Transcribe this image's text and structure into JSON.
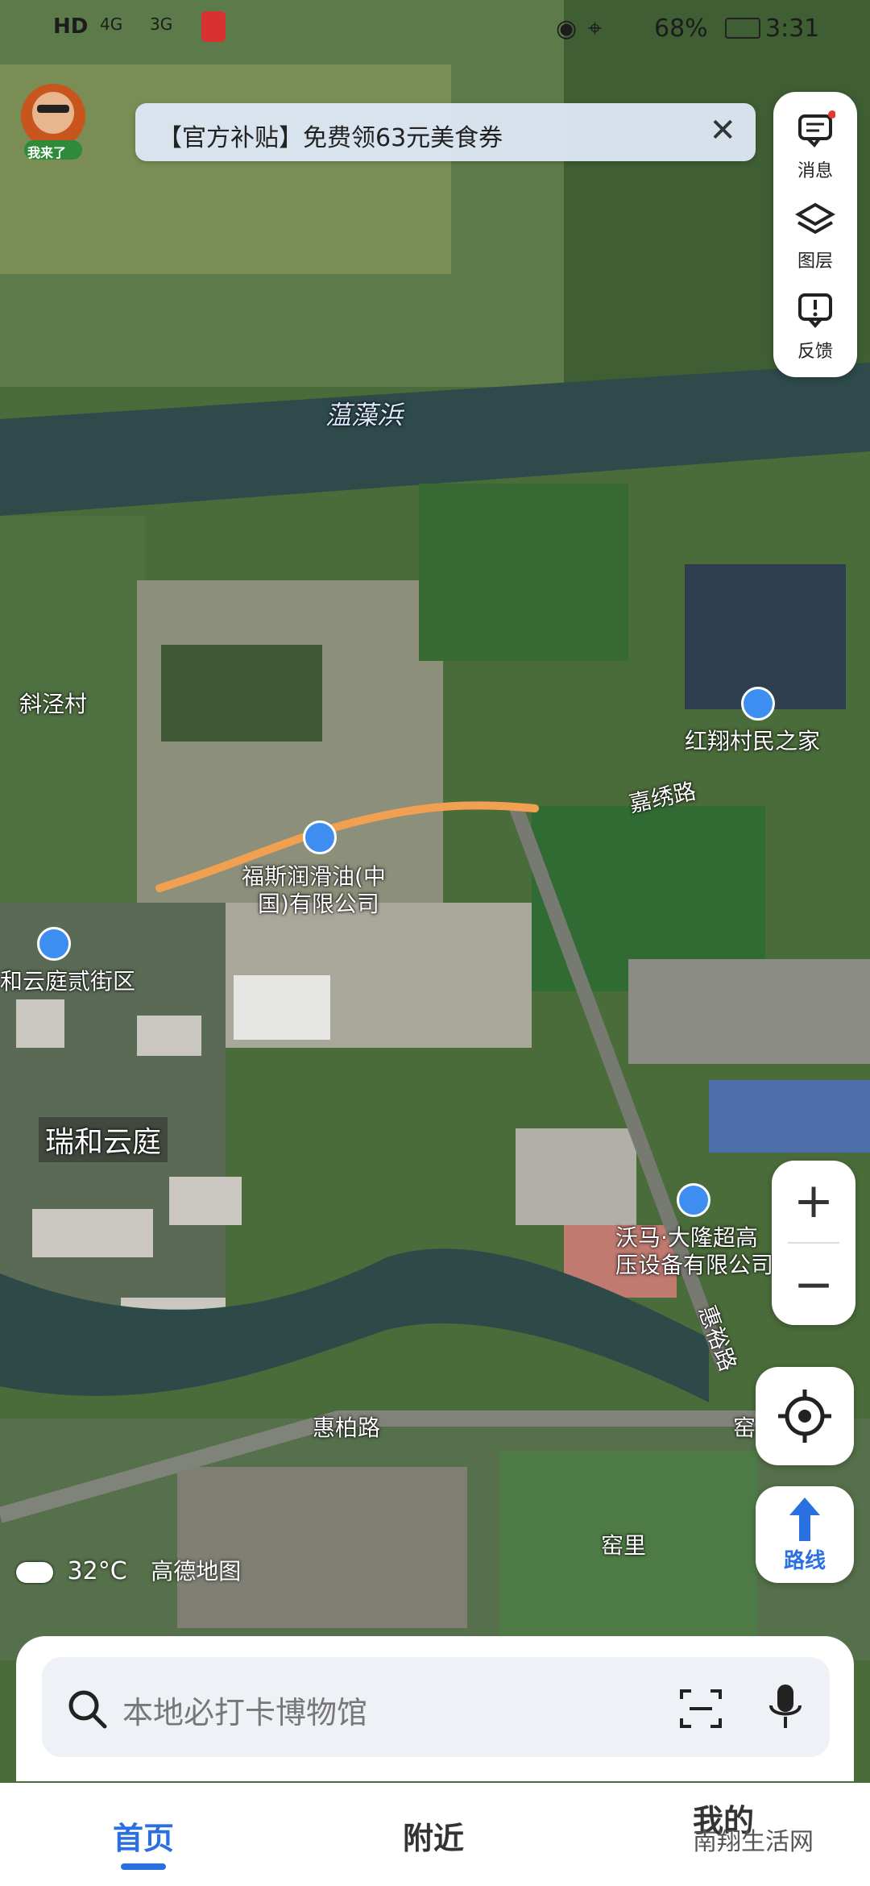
{
  "status_bar": {
    "network_left": "HD",
    "signal_1": "4G",
    "signal_2": "3G",
    "battery": "68%",
    "time": "3:31"
  },
  "banner": {
    "text": "【官方补贴】免费领63元美食券",
    "close_icon": "close-icon"
  },
  "avatar": {
    "badge": "我来了"
  },
  "right_panel": {
    "items": [
      {
        "label": "消息",
        "icon": "message-icon"
      },
      {
        "label": "图层",
        "icon": "layers-icon"
      },
      {
        "label": "反馈",
        "icon": "feedback-icon"
      }
    ]
  },
  "map_labels": {
    "river": "蕰藻浜",
    "village_west": "斜泾村",
    "community_center": "红翔村民之家",
    "road_jiaxiu": "嘉绣路",
    "company_line1": "福斯润滑油(中",
    "company_line2": "国)有限公司",
    "residential_area": "和云庭贰街区",
    "ruihe": "瑞和云庭",
    "walmart_line1": "沃马·大隆超高",
    "walmart_line2": "压设备有限公司",
    "road_huiyu": "惠裕路",
    "road_huibai": "惠柏路",
    "yaoli_edge": "窑",
    "yaoli": "窑里"
  },
  "weather": {
    "temp": "32°C",
    "brand": "高德地图"
  },
  "route_button": {
    "label": "路线"
  },
  "search": {
    "placeholder": "本地必打卡博物馆"
  },
  "tabs": [
    {
      "label": "首页",
      "active": true
    },
    {
      "label": "附近",
      "active": false
    },
    {
      "label": "我的",
      "active": false
    }
  ],
  "watermark": "南翔生活网",
  "colors": {
    "accent": "#2a70e0",
    "route_orange": "#f0a050",
    "poi_blue": "#3d8ef0"
  }
}
